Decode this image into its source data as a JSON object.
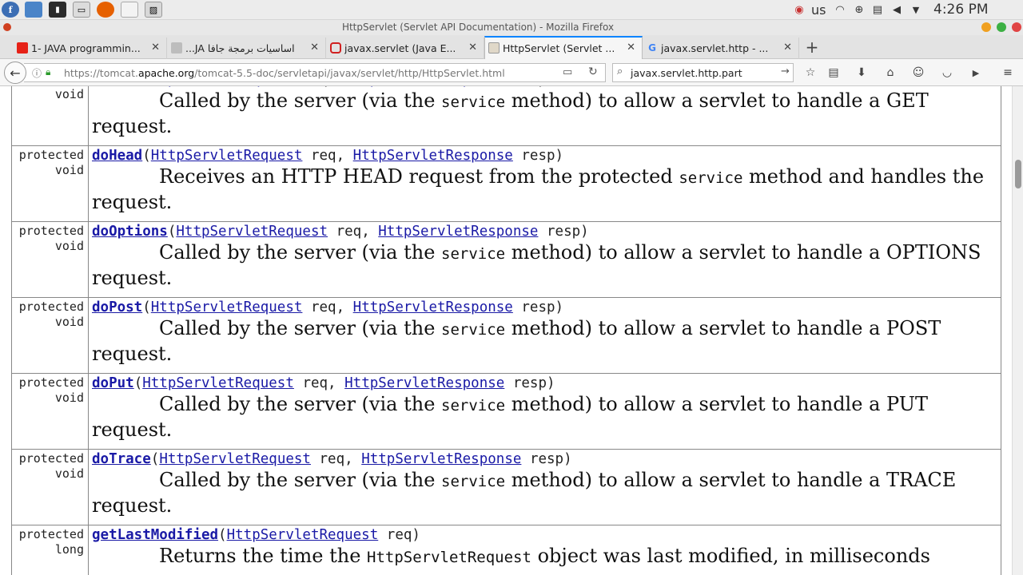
{
  "os_panel": {
    "clock": "4:26 PM",
    "keyboard_layout": "us",
    "launchers": [
      "fedora-icon",
      "file-manager-icon",
      "terminal-icon",
      "screenshot-icon",
      "firefox-icon",
      "text-editor-icon",
      "image-viewer-icon"
    ]
  },
  "window": {
    "title": "HttpServlet (Servlet API Documentation) - Mozilla Firefox"
  },
  "tabs": [
    {
      "label": "1- JAVA programmin...",
      "icon": "youtube-icon",
      "color": "#e62117"
    },
    {
      "label": "اساسيات برمجة جافا JA...",
      "icon": "page-icon",
      "color": "#9a9a9a"
    },
    {
      "label": "javax.servlet (Java E...",
      "icon": "oracle-icon",
      "color": "#d02020"
    },
    {
      "label": "HttpServlet (Servlet ...",
      "icon": "tomcat-icon",
      "color": "#888888"
    },
    {
      "label": "javax.servlet.http - ...",
      "icon": "google-icon",
      "color": "#4285f4"
    }
  ],
  "nav": {
    "url_prefix": "https://tomcat.",
    "url_host": "apache.org",
    "url_suffix": "/tomcat-5.5-doc/servletapi/javax/servlet/http/HttpServlet.html",
    "search_value": "javax.servlet.http.part"
  },
  "methods": [
    {
      "mod1": "protected",
      "mod2": "void",
      "name": "doGet",
      "params": [
        [
          "HttpServletRequest",
          "req"
        ],
        [
          "HttpServletResponse",
          "resp"
        ]
      ],
      "desc_before": "Called by the server (via the ",
      "desc_code": "service",
      "desc_after": " method) to allow a servlet to handle a GET request."
    },
    {
      "mod1": "protected",
      "mod2": "void",
      "name": "doHead",
      "params": [
        [
          "HttpServletRequest",
          "req"
        ],
        [
          "HttpServletResponse",
          "resp"
        ]
      ],
      "desc_before": "Receives an HTTP HEAD request from the protected ",
      "desc_code": "service",
      "desc_after": " method and handles the request."
    },
    {
      "mod1": "protected",
      "mod2": "void",
      "name": "doOptions",
      "params": [
        [
          "HttpServletRequest",
          "req"
        ],
        [
          "HttpServletResponse",
          "resp"
        ]
      ],
      "desc_before": "Called by the server (via the ",
      "desc_code": "service",
      "desc_after": " method) to allow a servlet to handle a OPTIONS request."
    },
    {
      "mod1": "protected",
      "mod2": "void",
      "name": "doPost",
      "params": [
        [
          "HttpServletRequest",
          "req"
        ],
        [
          "HttpServletResponse",
          "resp"
        ]
      ],
      "desc_before": "Called by the server (via the ",
      "desc_code": "service",
      "desc_after": " method) to allow a servlet to handle a POST request."
    },
    {
      "mod1": "protected",
      "mod2": "void",
      "name": "doPut",
      "params": [
        [
          "HttpServletRequest",
          "req"
        ],
        [
          "HttpServletResponse",
          "resp"
        ]
      ],
      "desc_before": "Called by the server (via the ",
      "desc_code": "service",
      "desc_after": " method) to allow a servlet to handle a PUT request."
    },
    {
      "mod1": "protected",
      "mod2": "void",
      "name": "doTrace",
      "params": [
        [
          "HttpServletRequest",
          "req"
        ],
        [
          "HttpServletResponse",
          "resp"
        ]
      ],
      "desc_before": "Called by the server (via the ",
      "desc_code": "service",
      "desc_after": " method) to allow a servlet to handle a TRACE request."
    },
    {
      "mod1": "protected",
      "mod2": "long",
      "name": "getLastModified",
      "params": [
        [
          "HttpServletRequest",
          "req"
        ]
      ],
      "desc_before": "Returns the time the ",
      "desc_code": "HttpServletRequest",
      "desc_after": " object was last modified, in milliseconds"
    }
  ]
}
